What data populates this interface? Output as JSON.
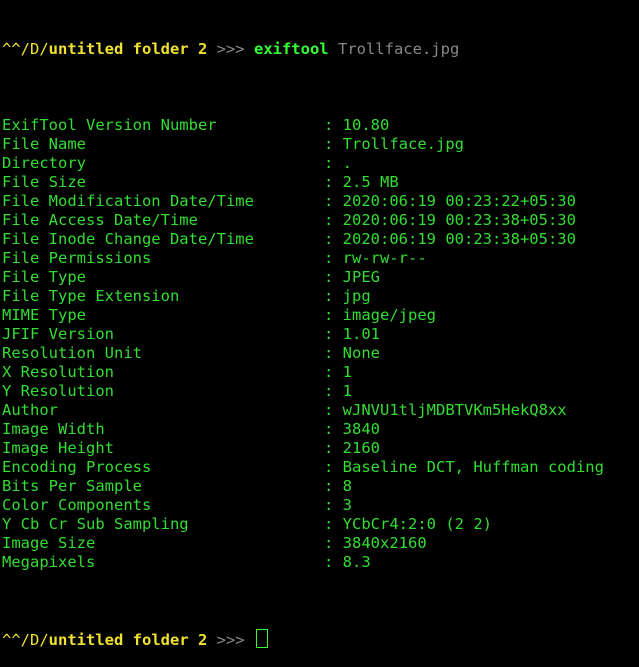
{
  "prompt": {
    "user_prefix": "^^/D/",
    "folder": "untitled folder 2",
    "arrow": " >>>"
  },
  "command": {
    "name": "exiftool",
    "argument": "Trollface.jpg"
  },
  "separator": ": ",
  "output": [
    {
      "key": "ExifTool Version Number",
      "value": "10.80"
    },
    {
      "key": "File Name",
      "value": "Trollface.jpg"
    },
    {
      "key": "Directory",
      "value": "."
    },
    {
      "key": "File Size",
      "value": "2.5 MB"
    },
    {
      "key": "File Modification Date/Time",
      "value": "2020:06:19 00:23:22+05:30"
    },
    {
      "key": "File Access Date/Time",
      "value": "2020:06:19 00:23:38+05:30"
    },
    {
      "key": "File Inode Change Date/Time",
      "value": "2020:06:19 00:23:38+05:30"
    },
    {
      "key": "File Permissions",
      "value": "rw-rw-r--"
    },
    {
      "key": "File Type",
      "value": "JPEG"
    },
    {
      "key": "File Type Extension",
      "value": "jpg"
    },
    {
      "key": "MIME Type",
      "value": "image/jpeg"
    },
    {
      "key": "JFIF Version",
      "value": "1.01"
    },
    {
      "key": "Resolution Unit",
      "value": "None"
    },
    {
      "key": "X Resolution",
      "value": "1"
    },
    {
      "key": "Y Resolution",
      "value": "1"
    },
    {
      "key": "Author",
      "value": "wJNVU1tljMDBTVKm5HekQ8xx"
    },
    {
      "key": "Image Width",
      "value": "3840"
    },
    {
      "key": "Image Height",
      "value": "2160"
    },
    {
      "key": "Encoding Process",
      "value": "Baseline DCT, Huffman coding"
    },
    {
      "key": "Bits Per Sample",
      "value": "8"
    },
    {
      "key": "Color Components",
      "value": "3"
    },
    {
      "key": "Y Cb Cr Sub Sampling",
      "value": "YCbCr4:2:0 (2 2)"
    },
    {
      "key": "Image Size",
      "value": "3840x2160"
    },
    {
      "key": "Megapixels",
      "value": "8.3"
    }
  ],
  "colors": {
    "background": "#000000",
    "text_green": "#33dd33",
    "prompt_yellow": "#f0e030",
    "arrow_gray": "#888888"
  }
}
